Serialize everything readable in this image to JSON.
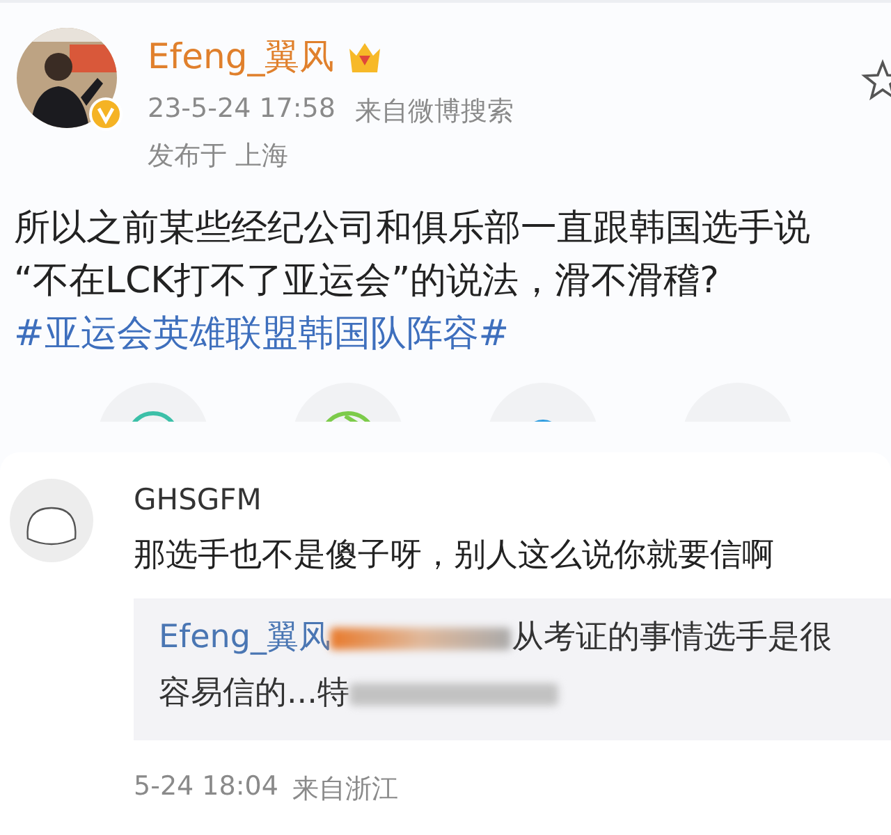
{
  "post": {
    "author": "Efeng_翼风",
    "time": "23-5-24 17:58",
    "source": "来自微博搜索",
    "location": "发布于 上海",
    "lines": [
      "所以之前某些经纪公司和俱乐部一直跟韩国选手说",
      "“不在LCK打不了亚运会”的说法，滑不滑稽?"
    ],
    "hashtag": "#亚运会英雄联盟韩国队阵容#",
    "verified": true
  },
  "comment": {
    "author": "GHSGFM",
    "text": "那选手也不是傻子呀，别人这么说你就要信啊",
    "quote": {
      "author": "Efeng_翼风",
      "line1": "从考证的事情选手是很",
      "line2": "容易信的...特"
    },
    "time": "5-24 18:04",
    "source": "来自浙江"
  }
}
